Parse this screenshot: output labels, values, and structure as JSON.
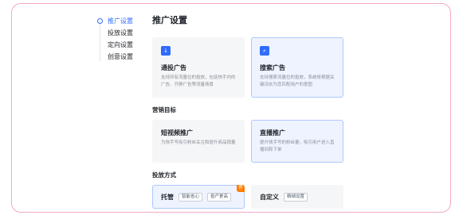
{
  "sidebar": {
    "items": [
      {
        "label": "推广设置",
        "active": true
      },
      {
        "label": "投放设置",
        "active": false
      },
      {
        "label": "定向设置",
        "active": false
      },
      {
        "label": "创意设置",
        "active": false
      }
    ]
  },
  "main": {
    "title": "推广设置",
    "promotion_types": [
      {
        "icon": "download-icon",
        "title": "通投广告",
        "desc": "支持所有流量位的投放，包括快手内的广告、开屏广告等流量场景",
        "selected": false
      },
      {
        "icon": "search-icon",
        "title": "搜索广告",
        "desc": "支持搜索流量位的投放，系统将根据关键词去为您匹配用户的意图",
        "selected": true
      }
    ],
    "marketing_goal": {
      "section_title": "营销目标",
      "options": [
        {
          "title": "短视频推广",
          "desc": "为快手号吸引粉丝关注和提升商品销量",
          "selected": false
        },
        {
          "title": "直播推广",
          "desc": "提升快手号的粉丝量，吸引用户进入直播间和下单",
          "selected": true
        }
      ]
    },
    "delivery_method": {
      "section_title": "投放方式",
      "options": [
        {
          "title": "托管",
          "tags": [
            "智能省心",
            "投产更高"
          ],
          "badge": "荐",
          "selected": true
        },
        {
          "title": "自定义",
          "tags": [
            "精细设置"
          ],
          "badge": "",
          "selected": false
        }
      ]
    }
  },
  "colors": {
    "accent": "#2f6bff",
    "frame_border": "#f3a9c6",
    "badge": "#ff7d00"
  }
}
